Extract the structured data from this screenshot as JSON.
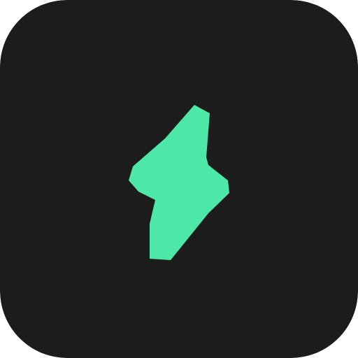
{
  "icon": {
    "name": "lightning-bolt-icon",
    "background_color": "#1c1c1c",
    "bolt_color": "#4de8a8"
  }
}
